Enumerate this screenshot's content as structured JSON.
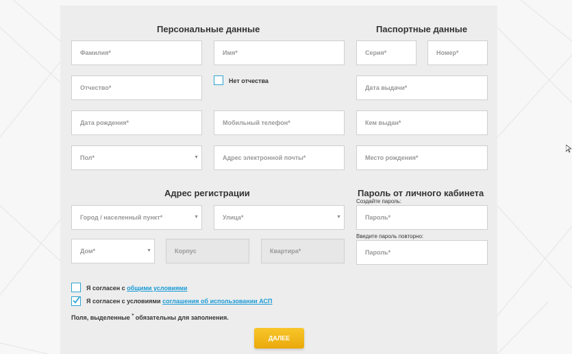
{
  "sections": {
    "personal_title": "Персональные данные",
    "passport_title": "Паспортные данные",
    "address_title": "Адрес регистрации",
    "password_title": "Пароль от личного кабинета"
  },
  "personal": {
    "surname": "Фамилия*",
    "name": "Имя*",
    "patronymic": "Отчество*",
    "no_patronymic_label": "Нет отчества",
    "birth_date": "Дата рождения*",
    "mobile_phone": "Мобильный телефон*",
    "gender": "Пол*",
    "email": "Адрес электронной почты*"
  },
  "passport": {
    "series": "Серия*",
    "number": "Номер*",
    "issue_date": "Дата выдачи*",
    "issued_by": "Кем выдан*",
    "birth_place": "Место рождения*"
  },
  "address": {
    "city": "Город / населенный пункт*",
    "street": "Улица*",
    "house": "Дом*",
    "building": "Корпус",
    "apartment": "Квартира*"
  },
  "password": {
    "create_label": "Создайте пароль:",
    "password_placeholder": "Пароль*",
    "repeat_label": "Введите пароль повторно:",
    "repeat_placeholder": "Пароль*"
  },
  "agreements": {
    "terms_prefix": "Я согласен с ",
    "terms_link": "общими условиями",
    "asp_prefix": "Я согласен с условиями ",
    "asp_link": "соглашения об использовании АСП",
    "required_prefix": "Поля, выделенные ",
    "required_star": "*",
    "required_suffix": " обязательны для заполнения."
  },
  "state": {
    "no_patronymic_checked": false,
    "terms_checked": false,
    "asp_checked": true
  },
  "buttons": {
    "next": "ДАЛЕЕ"
  },
  "colors": {
    "accent": "#29a3d0",
    "button": "#f2b71b",
    "link": "#1a9bd7"
  }
}
